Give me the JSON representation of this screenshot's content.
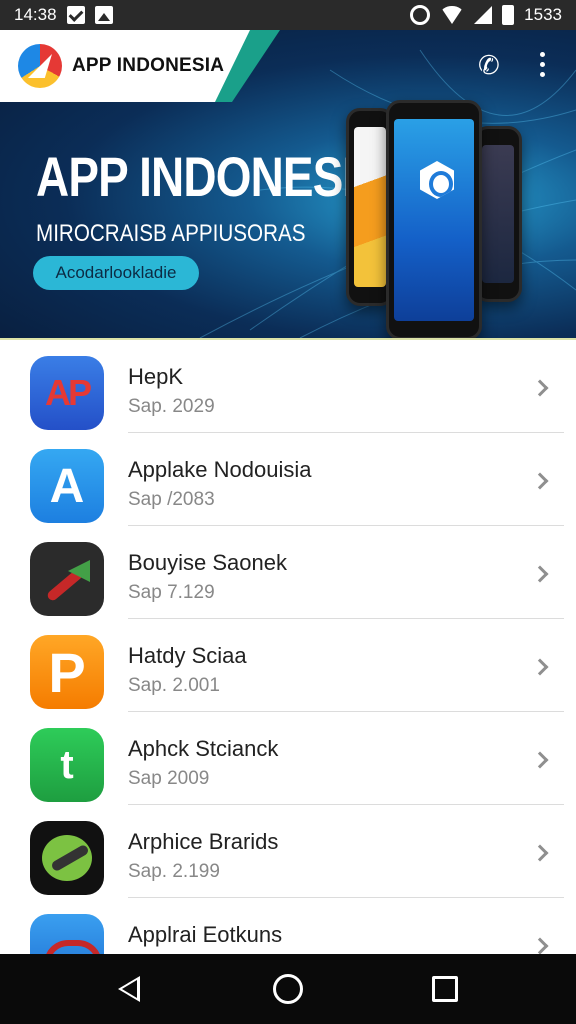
{
  "status_bar": {
    "time": "14:38",
    "battery_percent": "1533",
    "icons": [
      "check-notification-icon",
      "image-notification-icon",
      "alarm-icon",
      "wifi-icon",
      "signal-icon",
      "battery-icon"
    ]
  },
  "header": {
    "logo_text": "APP INDONESIA",
    "actions": [
      "phone-icon",
      "more-options-icon"
    ]
  },
  "banner": {
    "title": "APP INDONESIA",
    "subtitle": "MIROCRAISB APPIUSORAS",
    "chip_label": "Acodarlookladie"
  },
  "apps": [
    {
      "title": "HepK",
      "subtitle": "Sap. 2029",
      "icon": "ap-app-icon"
    },
    {
      "title": "Applake Nodouisia",
      "subtitle": "Sap /2083",
      "icon": "a-app-icon"
    },
    {
      "title": "Bouyise Saonek",
      "subtitle": "Sap 7.129",
      "icon": "dark-app-icon"
    },
    {
      "title": "Hatdy Sciaa",
      "subtitle": "Sap. 2.001",
      "icon": "p-app-icon"
    },
    {
      "title": "Aphck Stcianck",
      "subtitle": "Sap 2009",
      "icon": "green-app-icon"
    },
    {
      "title": "Arphice Brarids",
      "subtitle": "Sap. 2.199",
      "icon": "black-app-icon"
    },
    {
      "title": "Applrai Eotkuns",
      "subtitle": "",
      "icon": "blue-app-icon"
    }
  ],
  "colors": {
    "banner_dark": "#081c3a",
    "banner_accent": "#2bb7d6",
    "logo_stripe": "#1aa08a",
    "nav_bar": "#0a0a0a"
  }
}
